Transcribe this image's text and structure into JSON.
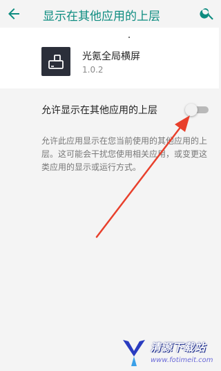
{
  "appbar": {
    "title": "显示在其他应用的上层",
    "back_icon": "arrow-back-icon",
    "search_icon": "search-icon"
  },
  "app": {
    "name": "光氪全局横屏",
    "version": "1.0.2",
    "icon": "app-rotate-icon"
  },
  "setting": {
    "label": "允许显示在其他应用的上层",
    "enabled": false,
    "description": "允许此应用显示在您当前使用的其他应用的上层。这可能会干扰您使用相关应用，或变更这类应用的显示或运行方式。"
  },
  "watermark": {
    "title": "清源下载站",
    "url": "www.fotimeit.com"
  },
  "colors": {
    "accent": "#0d8c80",
    "background": "#f4f4f4",
    "annotation_arrow": "#e8402c"
  }
}
